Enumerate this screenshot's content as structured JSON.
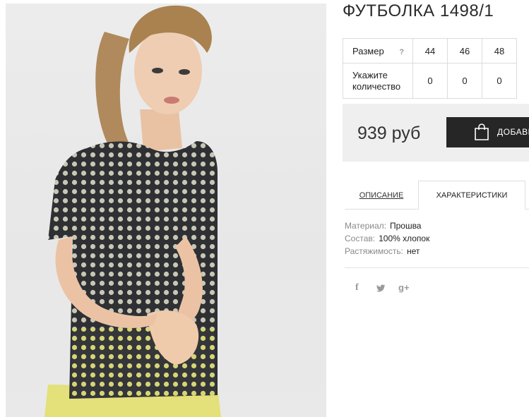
{
  "product": {
    "title": "ФУТБОЛКА 1498/1"
  },
  "size_table": {
    "size_label": "Размер",
    "help_icon": "?",
    "sizes": [
      "44",
      "46",
      "48"
    ],
    "qty_label_line1": "Укажите",
    "qty_label_line2": "количество",
    "quantities": [
      "0",
      "0",
      "0"
    ]
  },
  "buy": {
    "price": "939 руб",
    "add_button_label": "ДОБАВИТЬ В КОРЗИНУ",
    "icon": "shopping-bag-icon"
  },
  "tabs": [
    {
      "label": "ОПИСАНИЕ",
      "active": false
    },
    {
      "label": "ХАРАКТЕРИСТИКИ",
      "active": true
    }
  ],
  "specs": [
    {
      "key": "Материал:",
      "value": "Прошва"
    },
    {
      "key": "Состав:",
      "value": "100% хлопок"
    },
    {
      "key": "Растяжимость:",
      "value": "нет"
    }
  ],
  "social": {
    "facebook": "f",
    "twitter": "twitter-icon",
    "gplus": "g+"
  },
  "colors": {
    "button_bg": "#262626",
    "buy_box_bg": "#efefef",
    "border": "#dcdcdc"
  }
}
